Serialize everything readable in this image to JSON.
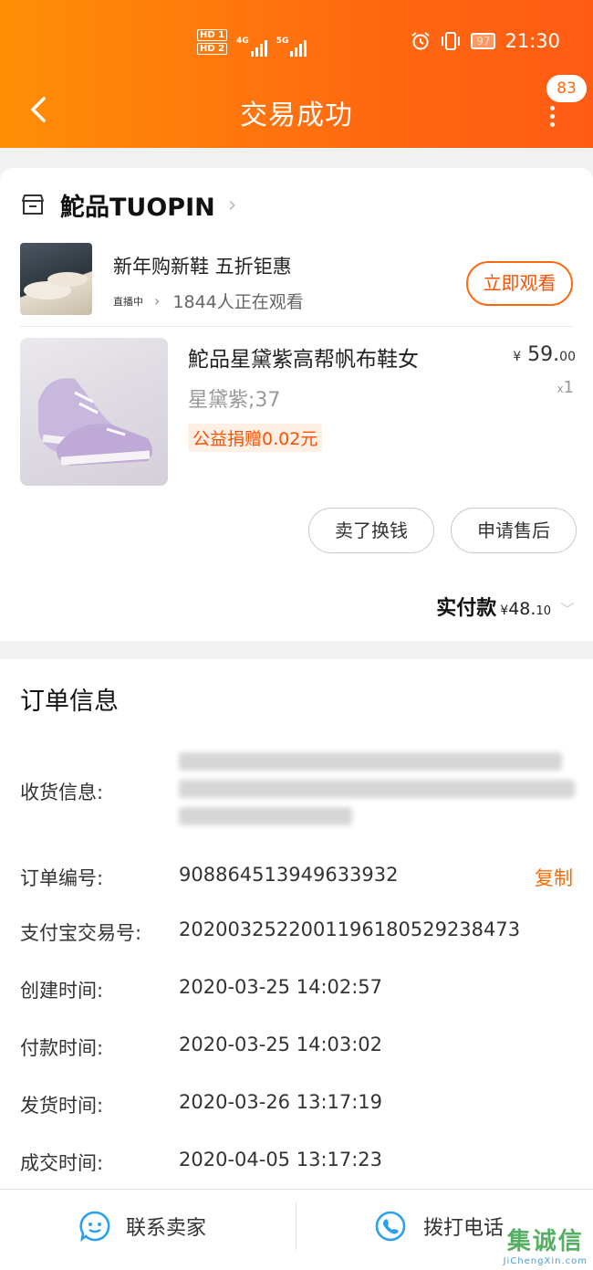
{
  "status_bar": {
    "hd1": "HD 1",
    "hd2": "HD 2",
    "net1": "4G",
    "net2": "5G",
    "battery": "97",
    "time": "21:30"
  },
  "header": {
    "title": "交易成功",
    "badge": "83"
  },
  "store": {
    "name": "鮀品TUOPIN"
  },
  "live": {
    "title": "新年购新鞋 五折钜惠",
    "tag": "直播中",
    "viewers": "1844人正在观看",
    "watch_label": "立即观看"
  },
  "product": {
    "name": "鮀品星黛紫高帮帆布鞋女",
    "sku": "星黛紫;37",
    "tag": "公益捐赠0.02元",
    "price_symbol": "¥",
    "price_int": "59.",
    "price_dec": "00",
    "qty_prefix": "x",
    "qty": "1"
  },
  "actions": {
    "sell": "卖了换钱",
    "after_sale": "申请售后"
  },
  "paid": {
    "label": "实付款",
    "symbol": "¥",
    "int": "48.",
    "dec": "10"
  },
  "order": {
    "title": "订单信息",
    "receiver_label": "收货信息:",
    "order_no_label": "订单编号:",
    "order_no": "908864513949633932",
    "copy_label": "复制",
    "alipay_label": "支付宝交易号:",
    "alipay_no": "2020032522001196180529238473",
    "created_label": "创建时间:",
    "created": "2020-03-25 14:02:57",
    "paid_label": "付款时间:",
    "paid": "2020-03-25 14:03:02",
    "shipped_label": "发货时间:",
    "shipped": "2020-03-26 13:17:19",
    "done_label": "成交时间:",
    "done": "2020-04-05 13:17:23"
  },
  "bottom": {
    "contact": "联系卖家",
    "call": "拨打电话"
  },
  "watermark": {
    "cn": "集诚信",
    "en": "JiChengXin.com"
  },
  "colors": {
    "accent": "#ff6a10",
    "price": "#ff5000",
    "link": "#ff6a00"
  }
}
